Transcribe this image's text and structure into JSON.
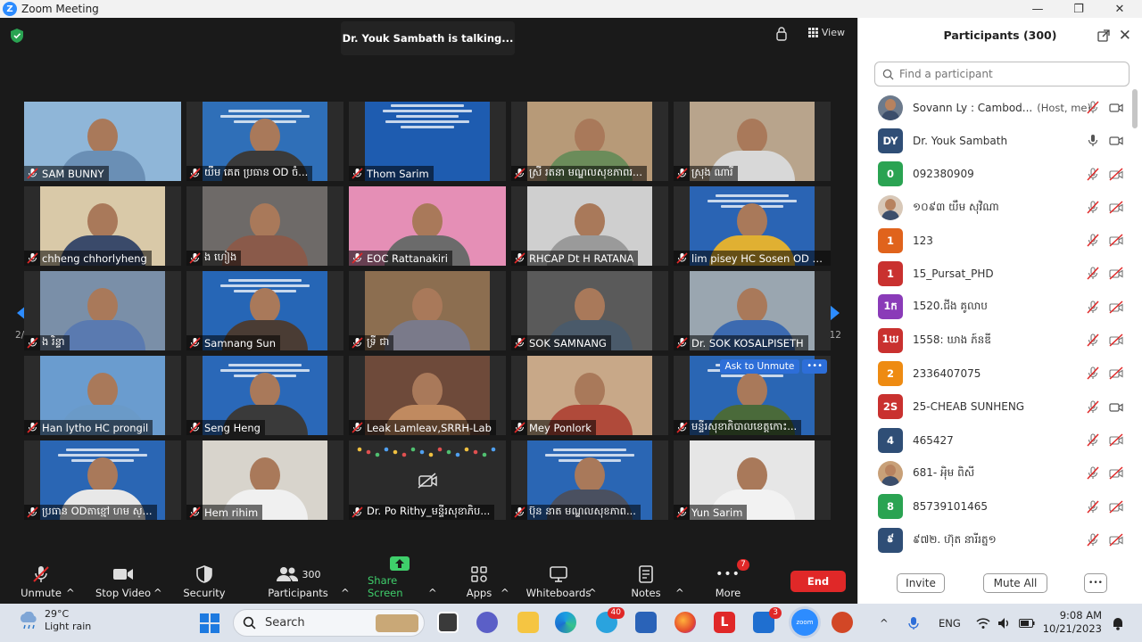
{
  "window": {
    "title": "Zoom Meeting",
    "app_letter": "Z",
    "controls": {
      "minimize": "—",
      "maximize": "❐",
      "close": "✕"
    }
  },
  "meeting": {
    "talking_banner": "Dr. Youk Sambath is talking...",
    "view_label": "View",
    "page_left": "2/12",
    "page_right": "2/12",
    "ask_to_unmute": "Ask to Unmute",
    "more_dots": "•••",
    "tiles": [
      {
        "name": "SAM BUNNY",
        "bg": "#8fb6d8",
        "style": "person",
        "shirt": "#6a8fb5"
      },
      {
        "name": "យឹម គេត ប្រធាន OD ចំ...",
        "bg": "#2f6fb8",
        "style": "banner",
        "shirt": "#3a3a3a"
      },
      {
        "name": "Thom Sarim",
        "bg": "#1e5cb0",
        "style": "slide",
        "shirt": "#1e5cb0"
      },
      {
        "name": "ស្រី រតនា មណ្ឌលសុខភាពរ...",
        "bg": "#b79a78",
        "style": "person",
        "shirt": "#6b8c5a"
      },
      {
        "name": "ស្រុង ណារី",
        "bg": "#b8a48c",
        "style": "person",
        "shirt": "#d8d8d8"
      },
      {
        "name": "chheng chhorlyheng",
        "bg": "#d9c9a8",
        "style": "person",
        "shirt": "#3a4a6a"
      },
      {
        "name": "ង ហៀង",
        "bg": "#6e6a68",
        "style": "room",
        "shirt": "#8a5a4a"
      },
      {
        "name": "EOC Rattanakiri",
        "bg": "#e58fb6",
        "style": "person",
        "shirt": "#6b6b6b"
      },
      {
        "name": "RHCAP Dt H RATANA",
        "bg": "#cfcfcf",
        "style": "room",
        "shirt": "#9a9a9a"
      },
      {
        "name": "lim pisey HC Sosen OD Pr...",
        "bg": "#2a64b4",
        "style": "banner",
        "shirt": "#e0b032"
      },
      {
        "name": "ង រិន្ទា",
        "bg": "#7a8fa8",
        "style": "person",
        "shirt": "#5a7ab0"
      },
      {
        "name": "Samnang Sun",
        "bg": "#2666b6",
        "style": "banner",
        "shirt": "#4a3c34"
      },
      {
        "name": "ទ្រី ជា",
        "bg": "#8c6e50",
        "style": "person",
        "shirt": "#7a7a8a"
      },
      {
        "name": "SOK SAMNANG",
        "bg": "#5a5a5a",
        "style": "person",
        "shirt": "#4a5a6a"
      },
      {
        "name": "Dr. SOK KOSALPISETH",
        "bg": "#9aa6b0",
        "style": "person",
        "shirt": "#3c6ab0"
      },
      {
        "name": "Han lytho HC prongil",
        "bg": "#6a9ccf",
        "style": "person",
        "shirt": "#6a9ac8"
      },
      {
        "name": "Seng Heng",
        "bg": "#2a68b8",
        "style": "banner",
        "shirt": "#3a3a3a"
      },
      {
        "name": "Leak Lamleav,SRRH-Lab",
        "bg": "#6e4a3a",
        "style": "person",
        "shirt": "#c08a60"
      },
      {
        "name": "Mey Ponlork",
        "bg": "#c8a888",
        "style": "person",
        "shirt": "#b04a3a"
      },
      {
        "name": "មន្ទីរសុខាភិបាលខេត្តកោះ...",
        "bg": "#2a66b4",
        "style": "banner",
        "shirt": "#4a6a3a",
        "ask": true
      },
      {
        "name": "ប្រធាន ODតាខ្មៅ ហម ស្...",
        "bg": "#2a66b4",
        "style": "banner",
        "shirt": "#e8e8e8"
      },
      {
        "name": "Hem rihim",
        "bg": "#d8d4cc",
        "style": "person",
        "shirt": "#f0f0f0"
      },
      {
        "name": "Dr. Po Rithy_មន្ទីរសុខាភិប...",
        "bg": "#555555",
        "style": "nocam",
        "shirt": "#555555"
      },
      {
        "name": "ប៊ុន នាត មណ្ឌលសុខភាព...",
        "bg": "#2a66b4",
        "style": "banner",
        "shirt": "#4a5060"
      },
      {
        "name": "Yun Sarim",
        "bg": "#e6e6e6",
        "style": "person",
        "shirt": "#f2f2f2"
      }
    ]
  },
  "toolbar": {
    "unmute": "Unmute",
    "stop_video": "Stop Video",
    "security": "Security",
    "participants": "Participants",
    "participants_count": "300",
    "share_screen": "Share Screen",
    "apps": "Apps",
    "whiteboards": "Whiteboards",
    "notes": "Notes",
    "more": "More",
    "more_badge": "7",
    "end": "End",
    "caret": "^"
  },
  "panel": {
    "title": "Participants (300)",
    "search_placeholder": "Find a participant",
    "close": "✕",
    "invite": "Invite",
    "mute_all": "Mute All",
    "more": "•••",
    "participants": [
      {
        "avatar": "",
        "photo": true,
        "color": "#6c7a8c",
        "name": "Sovann Ly : Cambod...",
        "role": "(Host, me)",
        "mic": "muted",
        "cam": "on"
      },
      {
        "avatar": "DY",
        "color": "#2f4e76",
        "name": "Dr. Youk Sambath",
        "role": "",
        "mic": "on",
        "cam": "on"
      },
      {
        "avatar": "0",
        "color": "#2aa352",
        "name": "092380909",
        "role": "",
        "mic": "muted",
        "cam": "off"
      },
      {
        "avatar": "",
        "photo": true,
        "color": "#d8c8b8",
        "name": "១០៩៣ យឹម សុវិណា",
        "role": "",
        "mic": "muted",
        "cam": "off"
      },
      {
        "avatar": "1",
        "color": "#e0631c",
        "name": "123",
        "role": "",
        "mic": "muted",
        "cam": "off"
      },
      {
        "avatar": "1",
        "color": "#c9312f",
        "name": "15_Pursat_PHD",
        "role": "",
        "mic": "muted",
        "cam": "off"
      },
      {
        "avatar": "1ក",
        "color": "#8a3bb8",
        "name": "1520.ជីង គូលាប",
        "role": "",
        "mic": "muted",
        "cam": "off"
      },
      {
        "avatar": "1ឃ",
        "color": "#c9312f",
        "name": "1558: ឃាង ភ៍នឌី",
        "role": "",
        "mic": "muted",
        "cam": "off"
      },
      {
        "avatar": "2",
        "color": "#ee8b12",
        "name": "2336407075",
        "role": "",
        "mic": "muted",
        "cam": "off"
      },
      {
        "avatar": "2S",
        "color": "#c9312f",
        "name": "25-CHEAB SUNHENG",
        "role": "",
        "mic": "muted",
        "cam": "on"
      },
      {
        "avatar": "4",
        "color": "#2f4e76",
        "name": "465427",
        "role": "",
        "mic": "muted",
        "cam": "off"
      },
      {
        "avatar": "",
        "photo": true,
        "color": "#c8a078",
        "name": "681- អុិម ពិសី",
        "role": "",
        "mic": "muted",
        "cam": "off"
      },
      {
        "avatar": "8",
        "color": "#2aa352",
        "name": "85739101465",
        "role": "",
        "mic": "muted",
        "cam": "off"
      },
      {
        "avatar": "៩",
        "color": "#2f4e76",
        "name": "៩៧២. ហ៊ុត នារីរត្ន១",
        "role": "",
        "mic": "muted",
        "cam": "off"
      }
    ]
  },
  "taskbar": {
    "temp": "29°C",
    "weather": "Light rain",
    "search": "Search",
    "lang": "ENG",
    "time": "9:08 AM",
    "date": "10/21/2023",
    "telegram_badge": "40",
    "mail_badge": "3",
    "zoom_label": "zoom",
    "office_letter": "L"
  },
  "colors": {
    "accent": "#2d8cff",
    "muted_red": "#e02828",
    "share_green": "#3fcf6b"
  }
}
